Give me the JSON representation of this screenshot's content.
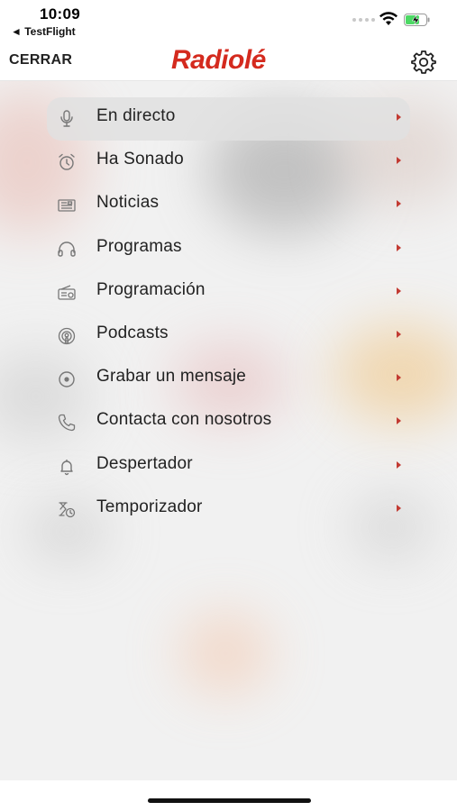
{
  "status": {
    "time": "10:09",
    "back_app": "◄ TestFlight"
  },
  "header": {
    "close_label": "CERRAR",
    "logo_text": "Radiolé",
    "settings_icon": "gear-icon"
  },
  "colors": {
    "accent": "#d42a1e",
    "chevron": "#c23a32",
    "battery_green": "#4cd964"
  },
  "menu": {
    "items": [
      {
        "label": "En directo",
        "icon": "microphone-icon",
        "active": true
      },
      {
        "label": "Ha Sonado",
        "icon": "alarm-clock-icon"
      },
      {
        "label": "Noticias",
        "icon": "newspaper-icon"
      },
      {
        "label": "Programas",
        "icon": "headphones-icon"
      },
      {
        "label": "Programación",
        "icon": "radio-icon"
      },
      {
        "label": "Podcasts",
        "icon": "podcast-icon"
      },
      {
        "label": "Grabar un mensaje",
        "icon": "record-icon"
      },
      {
        "label": "Contacta con nosotros",
        "icon": "phone-icon"
      },
      {
        "label": "Despertador",
        "icon": "bell-icon"
      },
      {
        "label": "Temporizador",
        "icon": "timer-icon"
      }
    ]
  }
}
